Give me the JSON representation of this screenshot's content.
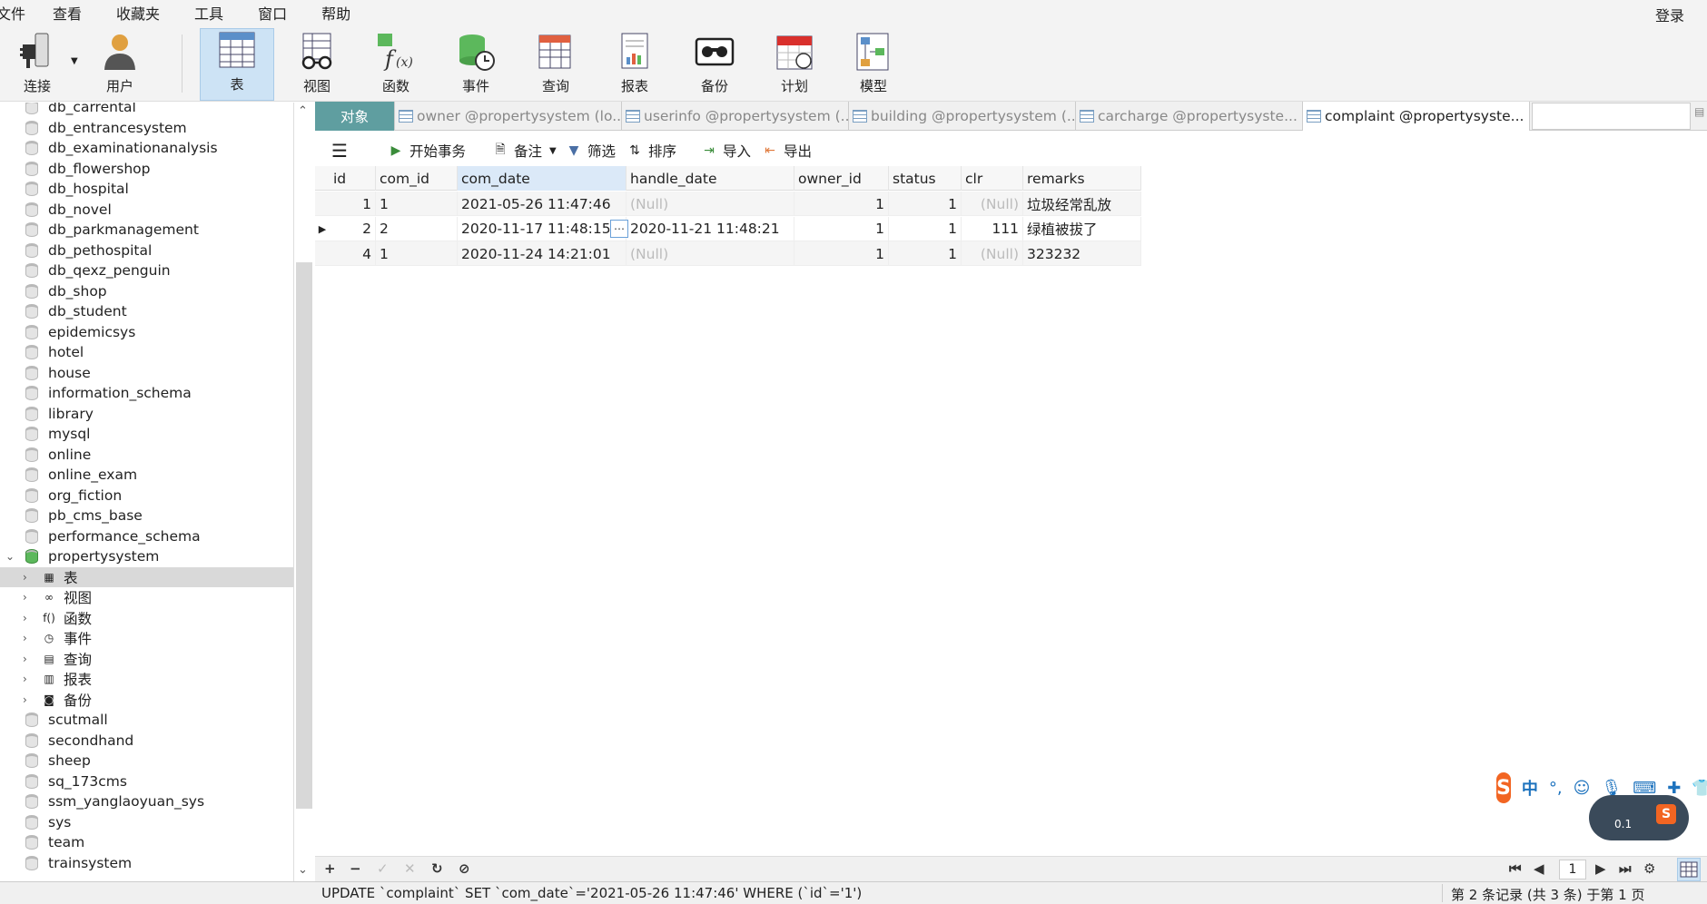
{
  "menu": [
    "文件",
    "查看",
    "收藏夹",
    "工具",
    "窗口",
    "帮助"
  ],
  "login": "登录",
  "toolbar": [
    {
      "label": "连接",
      "icon": "plug-icon"
    },
    {
      "label": "用户",
      "icon": "user-icon"
    },
    {
      "label": "表",
      "icon": "table-icon",
      "active": true
    },
    {
      "label": "视图",
      "icon": "view-glasses-icon"
    },
    {
      "label": "函数",
      "icon": "function-icon"
    },
    {
      "label": "事件",
      "icon": "event-clock-icon"
    },
    {
      "label": "查询",
      "icon": "query-icon"
    },
    {
      "label": "报表",
      "icon": "report-icon"
    },
    {
      "label": "备份",
      "icon": "backup-icon"
    },
    {
      "label": "计划",
      "icon": "calendar-icon"
    },
    {
      "label": "模型",
      "icon": "model-icon"
    }
  ],
  "sidebar": {
    "databases_top": [
      "db_carrental",
      "db_entrancesystem",
      "db_examinationanalysis",
      "db_flowershop",
      "db_hospital",
      "db_novel",
      "db_parkmanagement",
      "db_pethospital",
      "db_qexz_penguin",
      "db_shop",
      "db_student",
      "epidemicsys",
      "hotel",
      "house",
      "information_schema",
      "library",
      "mysql",
      "online",
      "online_exam",
      "org_fiction",
      "pb_cms_base",
      "performance_schema"
    ],
    "open_db": "propertysystem",
    "children": [
      {
        "label": "表",
        "icon": "table-icon"
      },
      {
        "label": "视图",
        "icon": "view-glasses-icon"
      },
      {
        "label": "函数",
        "icon": "function-icon"
      },
      {
        "label": "事件",
        "icon": "event-clock-icon"
      },
      {
        "label": "查询",
        "icon": "query-icon"
      },
      {
        "label": "报表",
        "icon": "report-icon"
      },
      {
        "label": "备份",
        "icon": "backup-icon"
      }
    ],
    "databases_bottom": [
      "scutmall",
      "secondhand",
      "sheep",
      "sq_173cms",
      "ssm_yanglaoyuan_sys",
      "sys",
      "team",
      "trainsystem"
    ]
  },
  "tabs": {
    "object": "对象",
    "items": [
      "owner @propertysystem (lo...",
      "userinfo @propertysystem (...",
      "building @propertysystem (...",
      "carcharge @propertysyste...",
      "complaint @propertysyste..."
    ]
  },
  "actions": {
    "menu": "menu-icon",
    "begin_tx": "开始事务",
    "note": "备注",
    "filter": "筛选",
    "sort": "排序",
    "import": "导入",
    "export": "导出"
  },
  "grid": {
    "columns": [
      "id",
      "com_id",
      "com_date",
      "handle_date",
      "owner_id",
      "status",
      "clr",
      "remarks"
    ],
    "rows": [
      [
        "1",
        "1",
        "2021-05-26 11:47:46",
        "(Null)",
        "1",
        "1",
        "(Null)",
        "垃圾经常乱放"
      ],
      [
        "2",
        "2",
        "2020-11-17 11:48:15",
        "2020-11-21 11:48:21",
        "1",
        "1",
        "111",
        "绿植被拔了"
      ],
      [
        "4",
        "1",
        "2020-11-24 14:21:01",
        "(Null)",
        "1",
        "1",
        "(Null)",
        "323232"
      ]
    ]
  },
  "nav": {
    "add": "+",
    "remove": "−",
    "apply": "✓",
    "discard": "✕",
    "refresh": "↻",
    "stop": "⊘",
    "page": "1"
  },
  "status": {
    "sql": "UPDATE `complaint` SET `com_date`='2021-05-26 11:47:46' WHERE (`id`='1')",
    "record": "第 2 条记录 (共 3 条) 于第 1 页"
  },
  "ime": {
    "speed": "0.1"
  }
}
